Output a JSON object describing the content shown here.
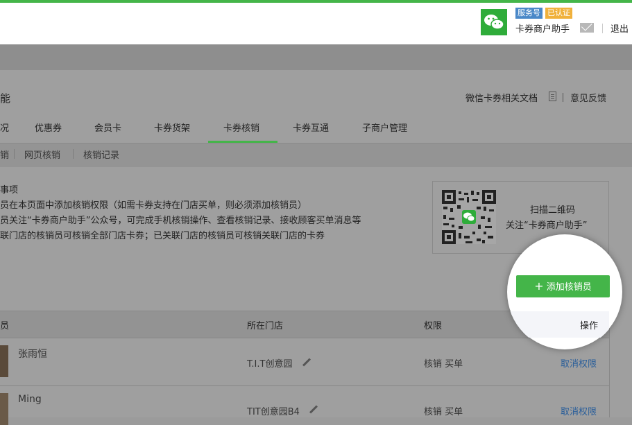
{
  "header": {
    "service_badge": "服务号",
    "verified_badge": "已认证",
    "account_name": "卡券商户助手",
    "logout": "退出"
  },
  "page": {
    "title": "能",
    "doc_link": "微信卡券相关文档",
    "feedback": "意见反馈"
  },
  "tabs": [
    "况",
    "优惠券",
    "会员卡",
    "卡券货架",
    "卡券核销",
    "卡券互通",
    "子商户管理"
  ],
  "active_tab": "卡券核销",
  "subtabs": [
    "销",
    "网页核销",
    "核销记录"
  ],
  "notice": {
    "title": "事项",
    "lines": [
      "员在本页面中添加核销权限（如需卡券支持在门店买单，则必须添加核销员）",
      "员关注“卡券商户助手”公众号，可完成手机核销操作、查看核销记录、接收顾客买单消息等",
      "联门店的核销员可核销全部门店卡券；已关联门店的核销员可核销关联门店的卡券"
    ]
  },
  "qr": {
    "line1": "扫描二维码",
    "line2": "关注“卡券商户助手”"
  },
  "add_button": "添加核销员",
  "table": {
    "headers": [
      "员",
      "所在门店",
      "权限",
      "操作"
    ],
    "rows": [
      {
        "name": "张雨恒",
        "store": "T.I.T创意园",
        "permission": "核销 买单",
        "action": "取消权限"
      },
      {
        "name": "Ming",
        "store": "TIT创意园B4",
        "permission": "核销 买单",
        "action": "取消权限"
      }
    ]
  },
  "colors": {
    "brand_green": "#44b549",
    "link_blue": "#2b5f9a",
    "overlay_gray": "#9f9f9f"
  }
}
